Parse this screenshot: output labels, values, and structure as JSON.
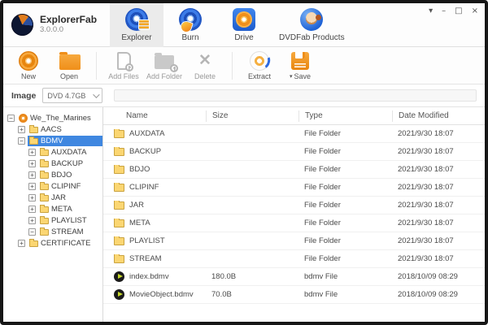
{
  "app": {
    "title": "ExplorerFab",
    "version": "3.0.0.0"
  },
  "window_controls": {
    "menu_glyph": "▾",
    "minimize_glyph": "–",
    "maximize_glyph": "□",
    "close_glyph": "×"
  },
  "nav": {
    "tabs": [
      {
        "label": "Explorer",
        "icon": "explorer-disc",
        "active": true
      },
      {
        "label": "Burn",
        "icon": "burn-disc",
        "active": false
      },
      {
        "label": "Drive",
        "icon": "drive",
        "active": false
      },
      {
        "label": "DVDFab Products",
        "icon": "dvdfab-monkey",
        "active": false
      }
    ]
  },
  "toolbar": {
    "buttons": [
      {
        "label": "New",
        "icon": "new-disc",
        "enabled": true
      },
      {
        "label": "Open",
        "icon": "open-folder",
        "enabled": true
      },
      {
        "label": "Add Files",
        "icon": "add-file",
        "enabled": false
      },
      {
        "label": "Add Folder",
        "icon": "add-folder",
        "enabled": false
      },
      {
        "label": "Delete",
        "icon": "delete-x",
        "enabled": false
      },
      {
        "label": "Extract",
        "icon": "extract-disc",
        "enabled": true
      },
      {
        "label": "Save",
        "icon": "save-floppy",
        "enabled": true,
        "dropdown_glyph": "▾"
      }
    ]
  },
  "image_bar": {
    "label": "Image",
    "selected_value": "DVD 4.7GB"
  },
  "tree": {
    "items": [
      {
        "label": "We_The_Marines",
        "level": 0,
        "expander": "minus",
        "icon": "disc",
        "selected": false
      },
      {
        "label": "AACS",
        "level": 1,
        "expander": "plus",
        "icon": "folder",
        "selected": false
      },
      {
        "label": "BDMV",
        "level": 1,
        "expander": "minus",
        "icon": "folder",
        "selected": true
      },
      {
        "label": "AUXDATA",
        "level": 2,
        "expander": "plus",
        "icon": "folder",
        "selected": false
      },
      {
        "label": "BACKUP",
        "level": 2,
        "expander": "plus",
        "icon": "folder",
        "selected": false
      },
      {
        "label": "BDJO",
        "level": 2,
        "expander": "plus",
        "icon": "folder",
        "selected": false
      },
      {
        "label": "CLIPINF",
        "level": 2,
        "expander": "plus",
        "icon": "folder",
        "selected": false
      },
      {
        "label": "JAR",
        "level": 2,
        "expander": "plus",
        "icon": "folder",
        "selected": false
      },
      {
        "label": "META",
        "level": 2,
        "expander": "plus",
        "icon": "folder",
        "selected": false
      },
      {
        "label": "PLAYLIST",
        "level": 2,
        "expander": "plus",
        "icon": "folder",
        "selected": false
      },
      {
        "label": "STREAM",
        "level": 2,
        "expander": "minus",
        "icon": "folder",
        "selected": false
      },
      {
        "label": "CERTIFICATE",
        "level": 1,
        "expander": "plus",
        "icon": "folder",
        "selected": false
      }
    ]
  },
  "filelist": {
    "columns": [
      "Name",
      "Size",
      "Type",
      "Date Modified"
    ],
    "rows": [
      {
        "name": "AUXDATA",
        "size": "",
        "type": "File Folder",
        "modified": "2021/9/30 18:07",
        "icon": "folder"
      },
      {
        "name": "BACKUP",
        "size": "",
        "type": "File Folder",
        "modified": "2021/9/30 18:07",
        "icon": "folder"
      },
      {
        "name": "BDJO",
        "size": "",
        "type": "File Folder",
        "modified": "2021/9/30 18:07",
        "icon": "folder"
      },
      {
        "name": "CLIPINF",
        "size": "",
        "type": "File Folder",
        "modified": "2021/9/30 18:07",
        "icon": "folder"
      },
      {
        "name": "JAR",
        "size": "",
        "type": "File Folder",
        "modified": "2021/9/30 18:07",
        "icon": "folder"
      },
      {
        "name": "META",
        "size": "",
        "type": "File Folder",
        "modified": "2021/9/30 18:07",
        "icon": "folder"
      },
      {
        "name": "PLAYLIST",
        "size": "",
        "type": "File Folder",
        "modified": "2021/9/30 18:07",
        "icon": "folder"
      },
      {
        "name": "STREAM",
        "size": "",
        "type": "File Folder",
        "modified": "2021/9/30 18:07",
        "icon": "folder"
      },
      {
        "name": "index.bdmv",
        "size": "180.0B",
        "type": "bdmv File",
        "modified": "2018/10/09 08:29",
        "icon": "bdmv"
      },
      {
        "name": "MovieObject.bdmv",
        "size": "70.0B",
        "type": "bdmv File",
        "modified": "2018/10/09 08:29",
        "icon": "bdmv"
      }
    ]
  },
  "colors": {
    "selection_blue": "#3f87e0",
    "accent_orange": "#ef8f1a",
    "folder_yellow": "#fbd672",
    "disc_blue": "#2f6be0"
  }
}
